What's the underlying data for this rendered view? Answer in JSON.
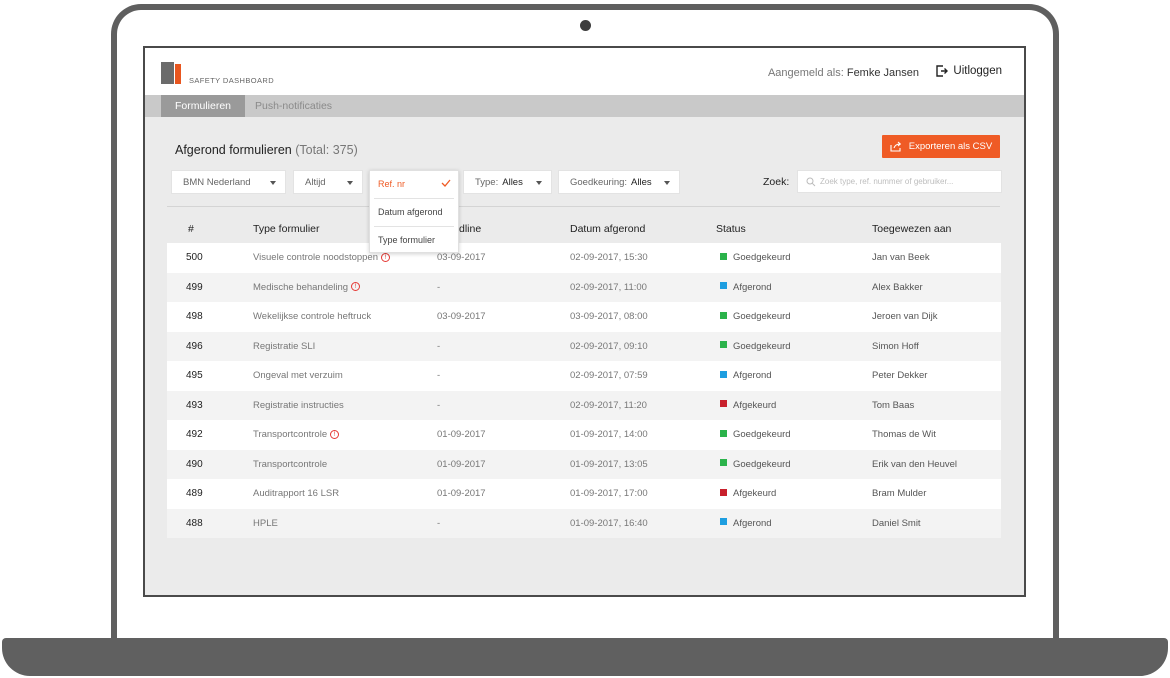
{
  "app": {
    "logo_text": "SAFETY DASHBOARD",
    "logged_in_label": "Aangemeld als:",
    "user_name": "Femke Jansen",
    "logout_label": "Uitloggen"
  },
  "tabs": [
    {
      "label": "Formulieren",
      "active": true
    },
    {
      "label": "Push-notificaties",
      "active": false
    }
  ],
  "page": {
    "title": "Afgerond formulieren",
    "total": "(Total: 375)",
    "export_label": "Exporteren als CSV"
  },
  "filters": {
    "organisation": "BMN Nederland",
    "period": "Altijd",
    "type_label": "Type:",
    "type_value": "Alles",
    "approval_label": "Goedkeuring:",
    "approval_value": "Alles",
    "search_label": "Zoek:",
    "search_placeholder": "Zoek type, ref. nummer of gebruiker...",
    "search_value": ""
  },
  "sort_dropdown": {
    "items": [
      "Ref. nr",
      "Datum afgerond",
      "Type formulier"
    ],
    "selected": "Ref. nr"
  },
  "columns": [
    "#",
    "Type formulier",
    "dline",
    "Datum afgerond",
    "Status",
    "Toegewezen aan"
  ],
  "status_colors": {
    "Goedgekeurd": "#2bb34b",
    "Afgerond": "#1e9ee0",
    "Afgekeurd": "#c8202c"
  },
  "accent_color": "#ef5b25",
  "rows": [
    {
      "ref": "500",
      "type": "Visuele controle noodstoppen",
      "warning": true,
      "deadline": "03-09-2017",
      "completed": "02-09-2017, 15:30",
      "status": "Goedgekeurd",
      "assignee": "Jan van Beek"
    },
    {
      "ref": "499",
      "type": "Medische behandeling",
      "warning": true,
      "deadline": "-",
      "completed": "02-09-2017, 11:00",
      "status": "Afgerond",
      "assignee": "Alex Bakker"
    },
    {
      "ref": "498",
      "type": "Wekelijkse controle heftruck",
      "warning": false,
      "deadline": "03-09-2017",
      "completed": "03-09-2017, 08:00",
      "status": "Goedgekeurd",
      "assignee": "Jeroen van Dijk"
    },
    {
      "ref": "496",
      "type": "Registratie SLI",
      "warning": false,
      "deadline": "-",
      "completed": "02-09-2017, 09:10",
      "status": "Goedgekeurd",
      "assignee": "Simon Hoff"
    },
    {
      "ref": "495",
      "type": "Ongeval met verzuim",
      "warning": false,
      "deadline": "-",
      "completed": "02-09-2017, 07:59",
      "status": "Afgerond",
      "assignee": "Peter Dekker"
    },
    {
      "ref": "493",
      "type": "Registratie instructies",
      "warning": false,
      "deadline": "-",
      "completed": "02-09-2017, 11:20",
      "status": "Afgekeurd",
      "assignee": "Tom Baas"
    },
    {
      "ref": "492",
      "type": "Transportcontrole",
      "warning": true,
      "deadline": "01-09-2017",
      "completed": "01-09-2017, 14:00",
      "status": "Goedgekeurd",
      "assignee": "Thomas de Wit"
    },
    {
      "ref": "490",
      "type": "Transportcontrole",
      "warning": false,
      "deadline": "01-09-2017",
      "completed": "01-09-2017, 13:05",
      "status": "Goedgekeurd",
      "assignee": "Erik van den Heuvel"
    },
    {
      "ref": "489",
      "type": "Auditrapport 16 LSR",
      "warning": false,
      "deadline": "01-09-2017",
      "completed": "01-09-2017, 17:00",
      "status": "Afgekeurd",
      "assignee": "Bram Mulder"
    },
    {
      "ref": "488",
      "type": "HPLE",
      "warning": false,
      "deadline": "-",
      "completed": "01-09-2017, 16:40",
      "status": "Afgerond",
      "assignee": "Daniel Smit"
    }
  ]
}
